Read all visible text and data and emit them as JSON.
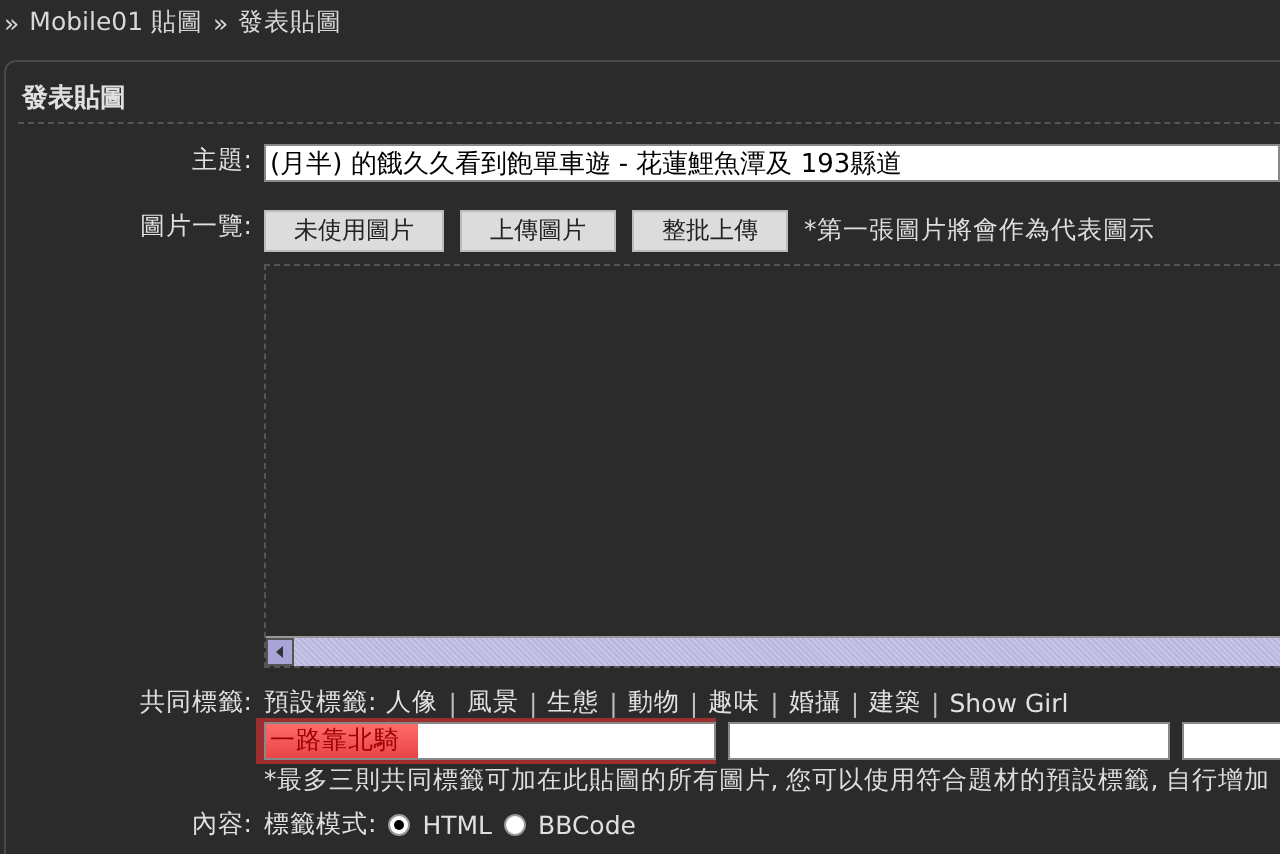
{
  "breadcrumb": [
    {
      "separator": "»",
      "label": "Mobile01 貼圖"
    },
    {
      "separator": "»",
      "label": "發表貼圖"
    }
  ],
  "panel": {
    "title": "發表貼圖",
    "subject": {
      "label": "主題:",
      "value": "(月半) 的餓久久看到飽單車遊 - 花蓮鯉魚潭及 193縣道"
    },
    "images": {
      "label": "圖片一覽:",
      "buttons": [
        "未使用圖片",
        "上傳圖片",
        "整批上傳"
      ],
      "note": "*第一張圖片將會作為代表圖示"
    },
    "tags": {
      "label": "共同標籤:",
      "preset_label": "預設標籤:",
      "preset": [
        "人像",
        "風景",
        "生態",
        "動物",
        "趣味",
        "婚攝",
        "建築",
        "Show Girl"
      ],
      "separator": "|",
      "inputs": [
        {
          "value": "一路靠北騎",
          "highlighted": true
        },
        {
          "highlighted": false
        },
        {
          "highlighted": false
        }
      ],
      "note": "*最多三則共同標籤可加在此貼圖的所有圖片, 您可以使用符合題材的預設標籤, 自行增加"
    },
    "content": {
      "label": "內容:",
      "mode_label": "標籤模式:",
      "modes": [
        {
          "label": "HTML",
          "selected": true
        },
        {
          "label": "BBCode",
          "selected": false
        }
      ]
    }
  }
}
